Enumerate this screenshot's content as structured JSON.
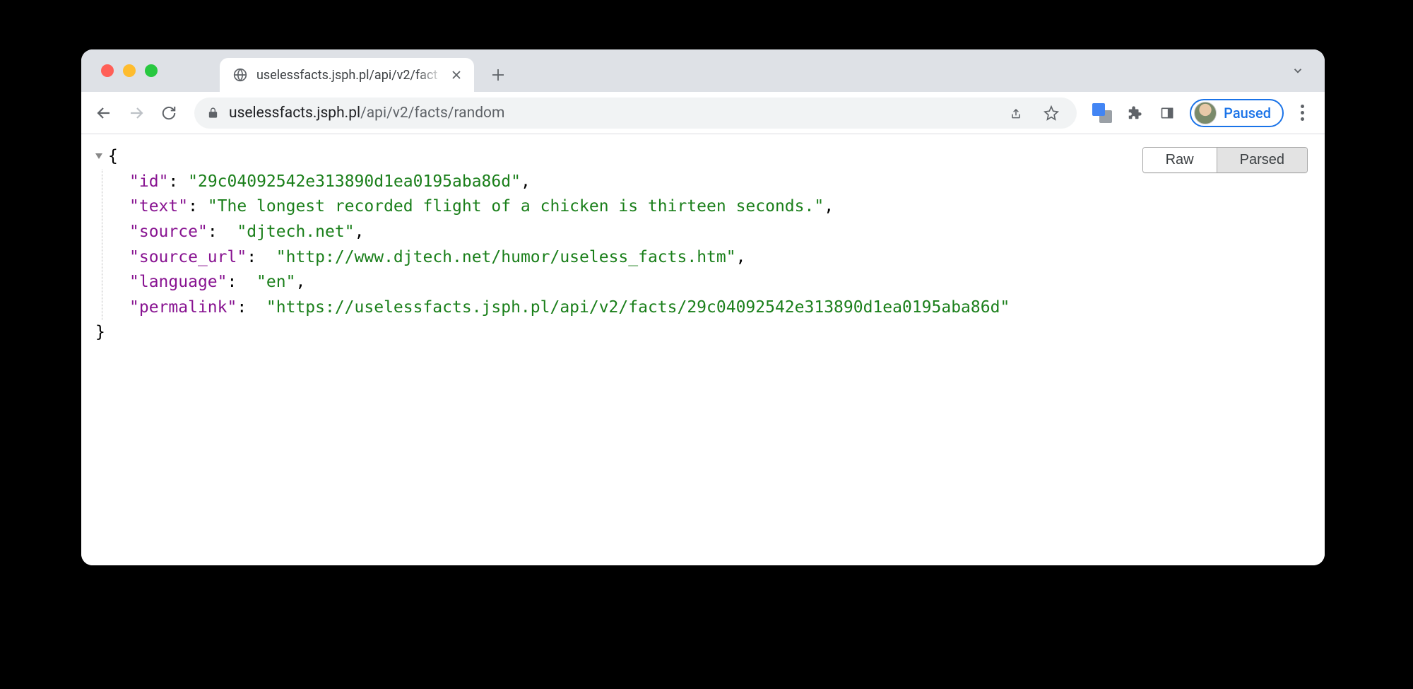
{
  "tab": {
    "title": "uselessfacts.jsph.pl/api/v2/fact"
  },
  "address": {
    "host": "uselessfacts.jsph.pl",
    "path": "/api/v2/facts/random"
  },
  "profile": {
    "status": "Paused"
  },
  "viewer": {
    "raw_label": "Raw",
    "parsed_label": "Parsed"
  },
  "json": {
    "id_key": "id",
    "id_val": "29c04092542e313890d1ea0195aba86d",
    "text_key": "text",
    "text_val": "The longest recorded flight of a chicken is thirteen seconds.",
    "source_key": "source",
    "source_val": "djtech.net",
    "source_url_key": "source_url",
    "source_url_val": "http://www.djtech.net/humor/useless_facts.htm",
    "language_key": "language",
    "language_val": "en",
    "permalink_key": "permalink",
    "permalink_val": "https://uselessfacts.jsph.pl/api/v2/facts/29c04092542e313890d1ea0195aba86d"
  }
}
